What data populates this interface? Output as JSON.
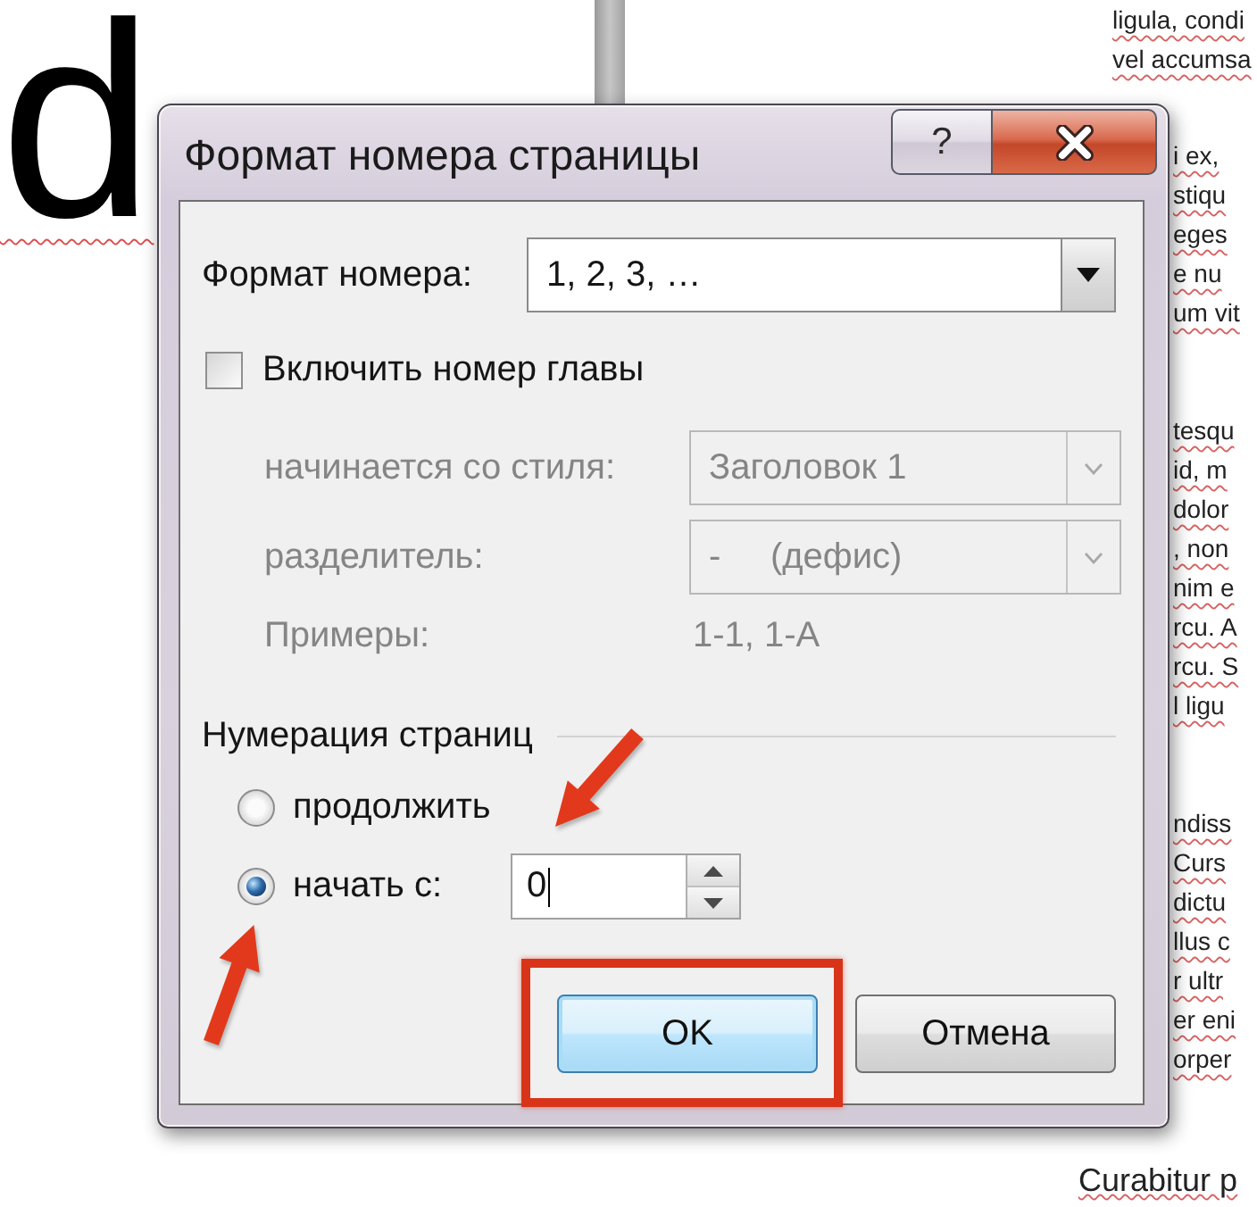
{
  "background": {
    "heading_fragment": "d",
    "paragraphs": [
      [
        "ligula, condi",
        "vel accumsa"
      ],
      [
        "i ex,",
        "stiqu",
        "eges",
        "e nu",
        "um vit"
      ],
      [
        "tesqu",
        "id, m",
        "dolor",
        ", non",
        "nim e",
        "rcu. A",
        "rcu. S",
        "l ligu"
      ],
      [
        "ndiss",
        "Curs",
        "dictu",
        "llus c",
        "r ultr",
        "er eni",
        "orper"
      ]
    ],
    "footer_line": "Curabitur p"
  },
  "dialog": {
    "title": "Формат номера страницы",
    "title_buttons": [
      {
        "kind": "help",
        "label": "?"
      },
      {
        "kind": "close"
      }
    ],
    "number_format": {
      "label": "Формат номера:",
      "value": "1, 2, 3, …"
    },
    "include_chapter": {
      "label": "Включить номер главы",
      "checked": false
    },
    "chapter_fields": [
      {
        "kind": "dropdown",
        "label": "начинается со стиля:",
        "value": "Заголовок 1",
        "disabled": true
      },
      {
        "kind": "dropdown",
        "label": "разделитель:",
        "value": "-     (дефис)",
        "disabled": true
      },
      {
        "kind": "text",
        "label": "Примеры:",
        "value": "1-1, 1-A",
        "disabled": true
      }
    ],
    "page_numbering": {
      "title": "Нумерация страниц",
      "options": [
        {
          "label": "продолжить",
          "selected": false,
          "pointer_arrow": false
        },
        {
          "label": "начать с:",
          "selected": true,
          "pointer_arrow": true
        }
      ],
      "start_at": {
        "value": "0",
        "pointer_arrow": true
      }
    },
    "buttons": [
      {
        "label": "OK",
        "focused": true,
        "highlighted": true
      },
      {
        "label": "Отмена",
        "focused": false,
        "highlighted": false
      }
    ]
  }
}
